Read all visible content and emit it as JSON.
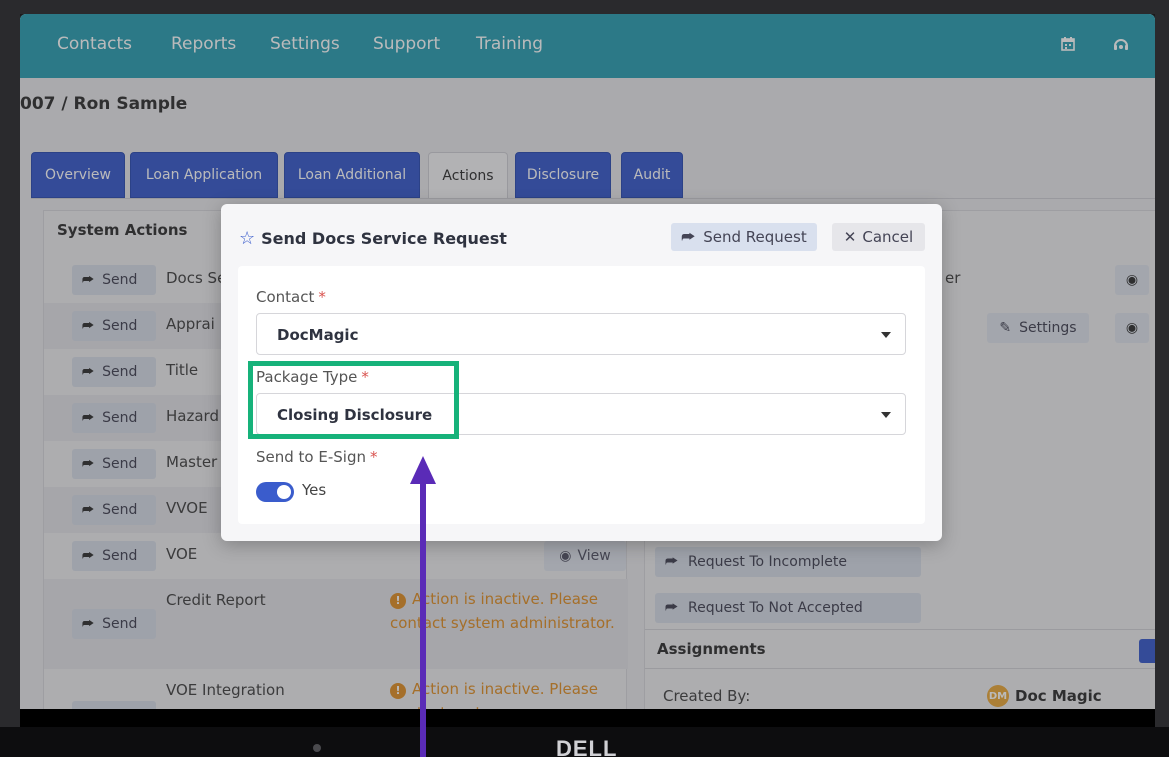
{
  "nav": {
    "items": [
      "Contacts",
      "Reports",
      "Settings",
      "Support",
      "Training"
    ],
    "icons": [
      "calendar-icon",
      "headset-icon"
    ]
  },
  "breadcrumb": "007 / Ron Sample",
  "tabs": [
    {
      "label": "Overview"
    },
    {
      "label": "Loan Application"
    },
    {
      "label": "Loan Additional"
    },
    {
      "label": "Actions",
      "active": true
    },
    {
      "label": "Disclosure"
    },
    {
      "label": "Audit"
    }
  ],
  "system_actions": {
    "title": "System Actions",
    "send_label": "Send",
    "rows": [
      {
        "label": "Docs Se"
      },
      {
        "label": "Apprai"
      },
      {
        "label": "Title"
      },
      {
        "label": "Hazard"
      },
      {
        "label": "Master"
      },
      {
        "label": "VVOE"
      },
      {
        "label": "VOE",
        "view": "View"
      },
      {
        "label": "Credit Report",
        "warning": "Action is inactive. Please contact system administrator."
      },
      {
        "label": "VOE Integration",
        "warning": "Action is inactive. Please contact system"
      }
    ]
  },
  "right_panel": {
    "partial_text": "er",
    "settings_label": "Settings",
    "buttons": [
      "Request To Incomplete",
      "Request To Not Accepted"
    ],
    "assignments_title": "Assignments",
    "created_by_label": "Created By:",
    "created_by_avatar": "DM",
    "created_by_value": "Doc Magic"
  },
  "modal": {
    "title": "Send Docs Service Request",
    "send_request_label": "Send Request",
    "cancel_label": "Cancel",
    "contact": {
      "label": "Contact",
      "value": "DocMagic"
    },
    "package_type": {
      "label": "Package Type",
      "value": "Closing Disclosure"
    },
    "esign": {
      "label": "Send to E-Sign",
      "toggle_label": "Yes",
      "on": true
    }
  },
  "device": {
    "brand": "DELL"
  },
  "colors": {
    "nav": "#2fa0b3",
    "tab": "#3a5ccc",
    "highlight": "#16b27a",
    "arrow": "#5a2bb7",
    "warning": "#e0912a"
  }
}
